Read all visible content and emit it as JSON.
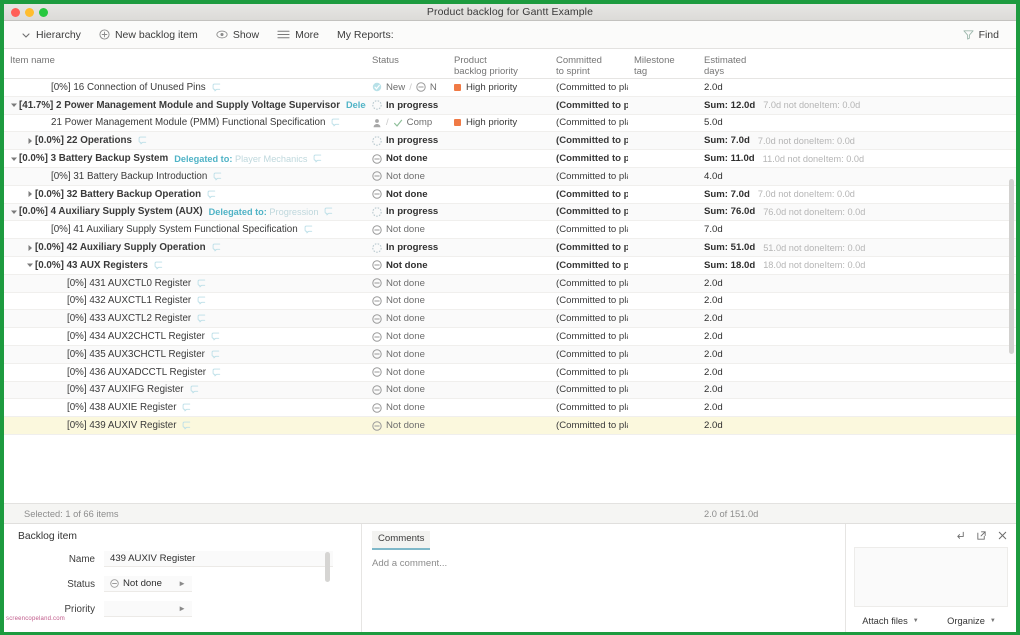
{
  "window": {
    "title": "Product backlog for Gantt Example",
    "traffic_lights": [
      "close",
      "minimize",
      "maximize"
    ]
  },
  "toolbar": {
    "items": [
      {
        "label": "Hierarchy",
        "icon": "chevron-down-icon"
      },
      {
        "label": "New backlog item",
        "icon": "plus-circle-icon"
      },
      {
        "label": "Show",
        "icon": "eye-icon"
      },
      {
        "label": "More",
        "icon": "hamburger-icon"
      },
      {
        "label": "My Reports:",
        "icon": "none"
      }
    ],
    "find": {
      "label": "Find",
      "icon": "funnel-icon"
    }
  },
  "table": {
    "columns": [
      {
        "key": "name",
        "line1": "Item name",
        "line2": ""
      },
      {
        "key": "status",
        "line1": "Status",
        "line2": ""
      },
      {
        "key": "priority",
        "line1": "Product",
        "line2": "backlog priority"
      },
      {
        "key": "sprint",
        "line1": "Committed",
        "line2": "to sprint"
      },
      {
        "key": "milestone",
        "line1": "Milestone",
        "line2": "tag"
      },
      {
        "key": "estimated",
        "line1": "Estimated",
        "line2": "days"
      }
    ],
    "rows": [
      {
        "indent": 3,
        "twisty": "",
        "bold": false,
        "name": "[0%] 16 Connection of Unused Pins",
        "status": "New",
        "status_icon": "new-icon",
        "status_bold": false,
        "status_extra": {
          "sep": "/",
          "icon": "minus-circle-icon",
          "text": "N"
        },
        "priority": "High priority",
        "priority_color": "#f07a45",
        "sprint": "(Committed to pla",
        "sprint_bold": false,
        "milestone": "",
        "est_main": "2.0d",
        "est_bold": false,
        "est_sub": ""
      },
      {
        "indent": 1,
        "twisty": "down",
        "bold": true,
        "name": "[41.7%] 2 Power Management Module and Supply Voltage Supervisor",
        "delegated_label": "Delegat",
        "delegated_value": "",
        "status": "In progress",
        "status_icon": "in-progress-icon",
        "status_bold": true,
        "priority": "",
        "sprint": "(Committed to pla",
        "sprint_bold": true,
        "milestone": "",
        "est_main": "Sum: 12.0d",
        "est_bold": true,
        "est_sub": "7.0d not doneItem: 0.0d"
      },
      {
        "indent": 3,
        "twisty": "",
        "bold": false,
        "name": "21 Power Management Module (PMM) Functional Specification",
        "status": "",
        "status_icon": "person-icon",
        "status_bold": false,
        "status_extra": {
          "sep": "/",
          "icon": "check-icon",
          "text": "Comp"
        },
        "priority": "High priority",
        "priority_color": "#f07a45",
        "sprint": "(Committed to pla",
        "sprint_bold": false,
        "milestone": "",
        "est_main": "5.0d",
        "est_bold": false,
        "est_sub": ""
      },
      {
        "indent": 2,
        "twisty": "right",
        "bold": true,
        "name": "[0.0%] 22 Operations",
        "status": "In progress",
        "status_icon": "in-progress-icon",
        "status_bold": true,
        "priority": "",
        "sprint": "(Committed to pla",
        "sprint_bold": true,
        "milestone": "",
        "est_main": "Sum: 7.0d",
        "est_bold": true,
        "est_sub": "7.0d not doneItem: 0.0d"
      },
      {
        "indent": 1,
        "twisty": "down",
        "bold": true,
        "name": "[0.0%] 3 Battery Backup System",
        "delegated_label": "Delegated to:",
        "delegated_value": "Player Mechanics",
        "status": "Not done",
        "status_icon": "not-done-icon",
        "status_bold": true,
        "priority": "",
        "sprint": "(Committed to pla",
        "sprint_bold": true,
        "milestone": "",
        "est_main": "Sum: 11.0d",
        "est_bold": true,
        "est_sub": "11.0d not doneItem: 0.0d"
      },
      {
        "indent": 3,
        "twisty": "",
        "bold": false,
        "name": "[0%] 31 Battery Backup Introduction",
        "status": "Not done",
        "status_icon": "not-done-icon",
        "status_bold": false,
        "priority": "",
        "sprint": "(Committed to pla",
        "sprint_bold": false,
        "milestone": "",
        "est_main": "4.0d",
        "est_bold": false,
        "est_sub": ""
      },
      {
        "indent": 2,
        "twisty": "right",
        "bold": true,
        "name": "[0.0%] 32 Battery Backup Operation",
        "status": "Not done",
        "status_icon": "not-done-icon",
        "status_bold": true,
        "priority": "",
        "sprint": "(Committed to pla",
        "sprint_bold": true,
        "milestone": "",
        "est_main": "Sum: 7.0d",
        "est_bold": true,
        "est_sub": "7.0d not doneItem: 0.0d"
      },
      {
        "indent": 1,
        "twisty": "down",
        "bold": true,
        "name": "[0.0%] 4 Auxiliary Supply System (AUX)",
        "delegated_label": "Delegated to:",
        "delegated_value": "Progression",
        "status": "In progress",
        "status_icon": "in-progress-icon",
        "status_bold": true,
        "priority": "",
        "sprint": "(Committed to pla",
        "sprint_bold": true,
        "milestone": "",
        "est_main": "Sum: 76.0d",
        "est_bold": true,
        "est_sub": "76.0d not doneItem: 0.0d"
      },
      {
        "indent": 3,
        "twisty": "",
        "bold": false,
        "name": "[0%] 41 Auxiliary Supply System Functional Specification",
        "status": "Not done",
        "status_icon": "not-done-icon",
        "status_bold": false,
        "priority": "",
        "sprint": "(Committed to pla",
        "sprint_bold": false,
        "milestone": "",
        "est_main": "7.0d",
        "est_bold": false,
        "est_sub": ""
      },
      {
        "indent": 2,
        "twisty": "right",
        "bold": true,
        "name": "[0.0%] 42 Auxiliary Supply Operation",
        "status": "In progress",
        "status_icon": "in-progress-icon",
        "status_bold": true,
        "priority": "",
        "sprint": "(Committed to pla",
        "sprint_bold": true,
        "milestone": "",
        "est_main": "Sum: 51.0d",
        "est_bold": true,
        "est_sub": "51.0d not doneItem: 0.0d"
      },
      {
        "indent": 2,
        "twisty": "down",
        "bold": true,
        "name": "[0.0%] 43 AUX Registers",
        "status": "Not done",
        "status_icon": "not-done-icon",
        "status_bold": true,
        "priority": "",
        "sprint": "(Committed to pla",
        "sprint_bold": true,
        "milestone": "",
        "est_main": "Sum: 18.0d",
        "est_bold": true,
        "est_sub": "18.0d not doneItem: 0.0d"
      },
      {
        "indent": 4,
        "twisty": "",
        "bold": false,
        "name": "[0%] 431 AUXCTL0 Register",
        "status": "Not done",
        "status_icon": "not-done-icon",
        "status_bold": false,
        "priority": "",
        "sprint": "(Committed to pla",
        "sprint_bold": false,
        "milestone": "",
        "est_main": "2.0d",
        "est_bold": false,
        "est_sub": ""
      },
      {
        "indent": 4,
        "twisty": "",
        "bold": false,
        "name": "[0%] 432 AUXCTL1 Register",
        "status": "Not done",
        "status_icon": "not-done-icon",
        "status_bold": false,
        "priority": "",
        "sprint": "(Committed to pla",
        "sprint_bold": false,
        "milestone": "",
        "est_main": "2.0d",
        "est_bold": false,
        "est_sub": ""
      },
      {
        "indent": 4,
        "twisty": "",
        "bold": false,
        "name": "[0%] 433 AUXCTL2 Register",
        "status": "Not done",
        "status_icon": "not-done-icon",
        "status_bold": false,
        "priority": "",
        "sprint": "(Committed to pla",
        "sprint_bold": false,
        "milestone": "",
        "est_main": "2.0d",
        "est_bold": false,
        "est_sub": ""
      },
      {
        "indent": 4,
        "twisty": "",
        "bold": false,
        "name": "[0%] 434 AUX2CHCTL Register",
        "status": "Not done",
        "status_icon": "not-done-icon",
        "status_bold": false,
        "priority": "",
        "sprint": "(Committed to pla",
        "sprint_bold": false,
        "milestone": "",
        "est_main": "2.0d",
        "est_bold": false,
        "est_sub": ""
      },
      {
        "indent": 4,
        "twisty": "",
        "bold": false,
        "name": "[0%] 435 AUX3CHCTL Register",
        "status": "Not done",
        "status_icon": "not-done-icon",
        "status_bold": false,
        "priority": "",
        "sprint": "(Committed to pla",
        "sprint_bold": false,
        "milestone": "",
        "est_main": "2.0d",
        "est_bold": false,
        "est_sub": ""
      },
      {
        "indent": 4,
        "twisty": "",
        "bold": false,
        "name": "[0%] 436 AUXADCCTL Register",
        "status": "Not done",
        "status_icon": "not-done-icon",
        "status_bold": false,
        "priority": "",
        "sprint": "(Committed to pla",
        "sprint_bold": false,
        "milestone": "",
        "est_main": "2.0d",
        "est_bold": false,
        "est_sub": ""
      },
      {
        "indent": 4,
        "twisty": "",
        "bold": false,
        "name": "[0%] 437 AUXIFG Register",
        "status": "Not done",
        "status_icon": "not-done-icon",
        "status_bold": false,
        "priority": "",
        "sprint": "(Committed to pla",
        "sprint_bold": false,
        "milestone": "",
        "est_main": "2.0d",
        "est_bold": false,
        "est_sub": ""
      },
      {
        "indent": 4,
        "twisty": "",
        "bold": false,
        "name": "[0%] 438 AUXIE Register",
        "status": "Not done",
        "status_icon": "not-done-icon",
        "status_bold": false,
        "priority": "",
        "sprint": "(Committed to pla",
        "sprint_bold": false,
        "milestone": "",
        "est_main": "2.0d",
        "est_bold": false,
        "est_sub": ""
      },
      {
        "indent": 4,
        "twisty": "",
        "bold": false,
        "selected": true,
        "name": "[0%] 439 AUXIV Register",
        "status": "Not done",
        "status_icon": "not-done-icon",
        "status_bold": false,
        "priority": "",
        "sprint": "(Committed to pla",
        "sprint_bold": false,
        "milestone": "",
        "est_main": "2.0d",
        "est_bold": false,
        "est_sub": ""
      }
    ]
  },
  "summary": {
    "selection": "Selected: 1 of 66 items",
    "total": "2.0 of 151.0d"
  },
  "detail": {
    "panel_title": "Backlog item",
    "fields": [
      {
        "label": "Name",
        "value": "439 AUXIV Register",
        "type": "text"
      },
      {
        "label": "Status",
        "value": "Not done",
        "type": "select",
        "icon": "not-done-icon"
      },
      {
        "label": "Priority",
        "value": "",
        "type": "select",
        "icon": "none"
      }
    ],
    "watermark": "screencopeland.com",
    "comments": {
      "tab_label": "Comments",
      "placeholder": "Add a comment..."
    },
    "attachments": {
      "icons": [
        "expand-icon",
        "popout-icon",
        "close-icon"
      ],
      "buttons": [
        {
          "label": "Attach files"
        },
        {
          "label": "Organize"
        }
      ]
    }
  },
  "colors": {
    "accent_green": "#1d9b3f",
    "priority_high": "#f07a45",
    "delegated_label": "#4fb3c6",
    "selected_row": "#fbf8dd"
  }
}
